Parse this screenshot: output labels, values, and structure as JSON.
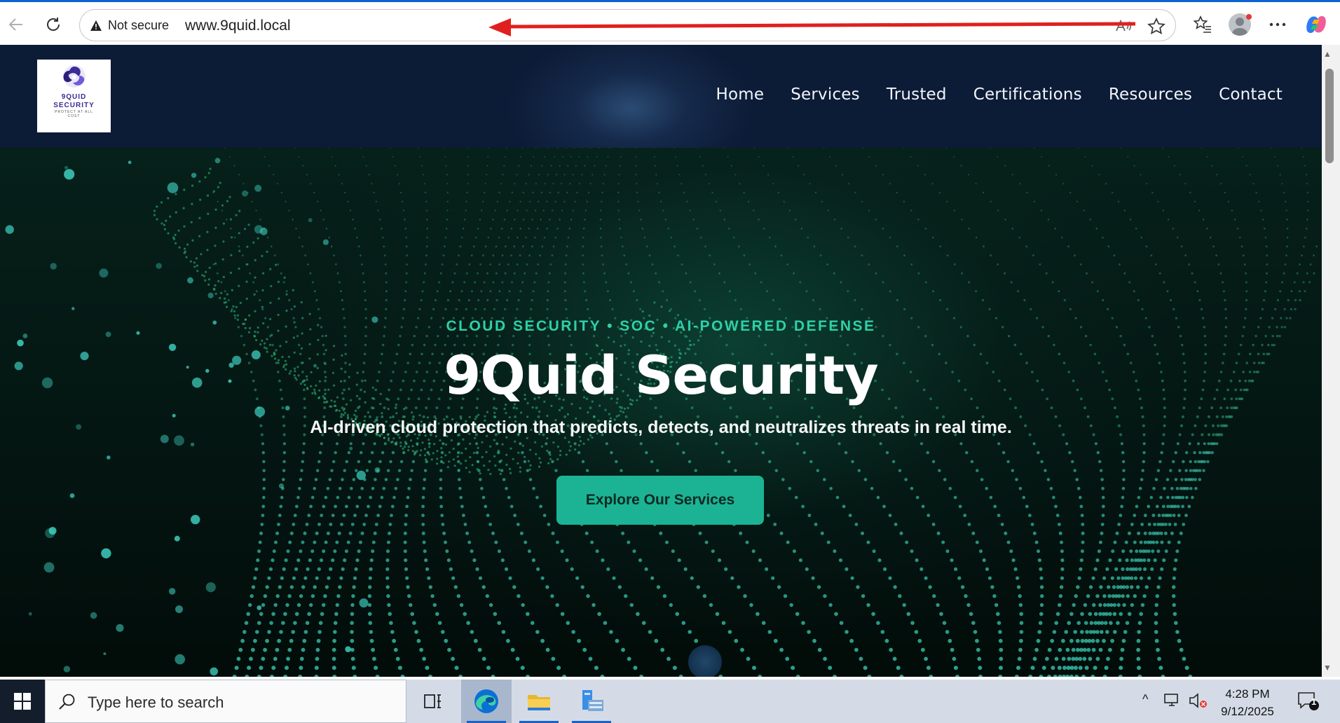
{
  "browser": {
    "security_label": "Not secure",
    "url": "www.9quid.local",
    "colors": {
      "tab_accent": "#0b63d1",
      "annotation_arrow": "#e0201f"
    }
  },
  "site": {
    "logo": {
      "name_line1": "9QUID",
      "name_line2": "SECURITY",
      "tagline": "PROTECT AT ALL COST"
    },
    "nav": [
      "Home",
      "Services",
      "Trusted",
      "Certifications",
      "Resources",
      "Contact"
    ],
    "hero": {
      "kicker": "CLOUD SECURITY • SOC • AI-POWERED DEFENSE",
      "title": "9Quid Security",
      "subtitle": "AI-driven cloud protection that predicts, detects, and neutralizes threats in real time.",
      "cta": "Explore Our Services"
    },
    "colors": {
      "accent": "#1cb394",
      "kicker": "#2fd0a8",
      "header_bg": "#0c1b36"
    }
  },
  "taskbar": {
    "search_placeholder": "Type here to search",
    "time": "4:28 PM",
    "date": "9/12/2025",
    "notification_count": "1",
    "apps": [
      "task-view",
      "edge",
      "file-explorer",
      "server-manager"
    ]
  }
}
